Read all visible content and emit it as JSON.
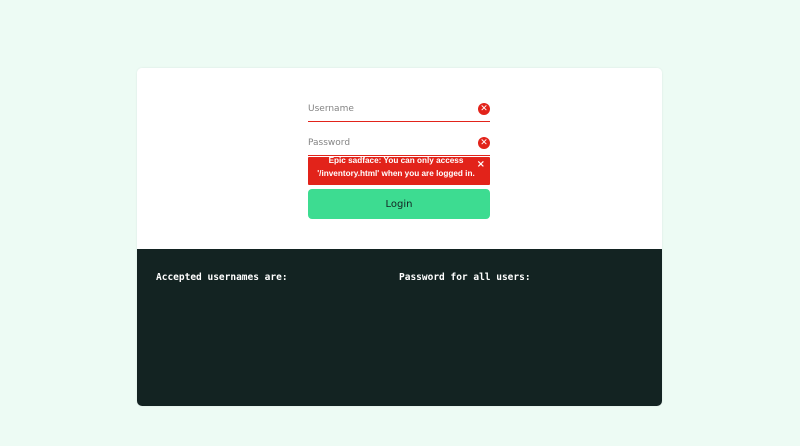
{
  "login": {
    "username_placeholder": "Username",
    "password_placeholder": "Password",
    "username_value": "",
    "password_value": "",
    "error_icon": "x-circle-icon",
    "error_message": "Epic sadface: You can only access '/inventory.html' when you are logged in.",
    "close_glyph": "×",
    "login_label": "Login"
  },
  "credentials": {
    "usernames_heading": "Accepted usernames are:",
    "password_heading": "Password for all users:"
  },
  "colors": {
    "page_bg": "#edfbf4",
    "error": "#e2231a",
    "login_button": "#3ddc91",
    "credentials_bg": "#132322"
  }
}
